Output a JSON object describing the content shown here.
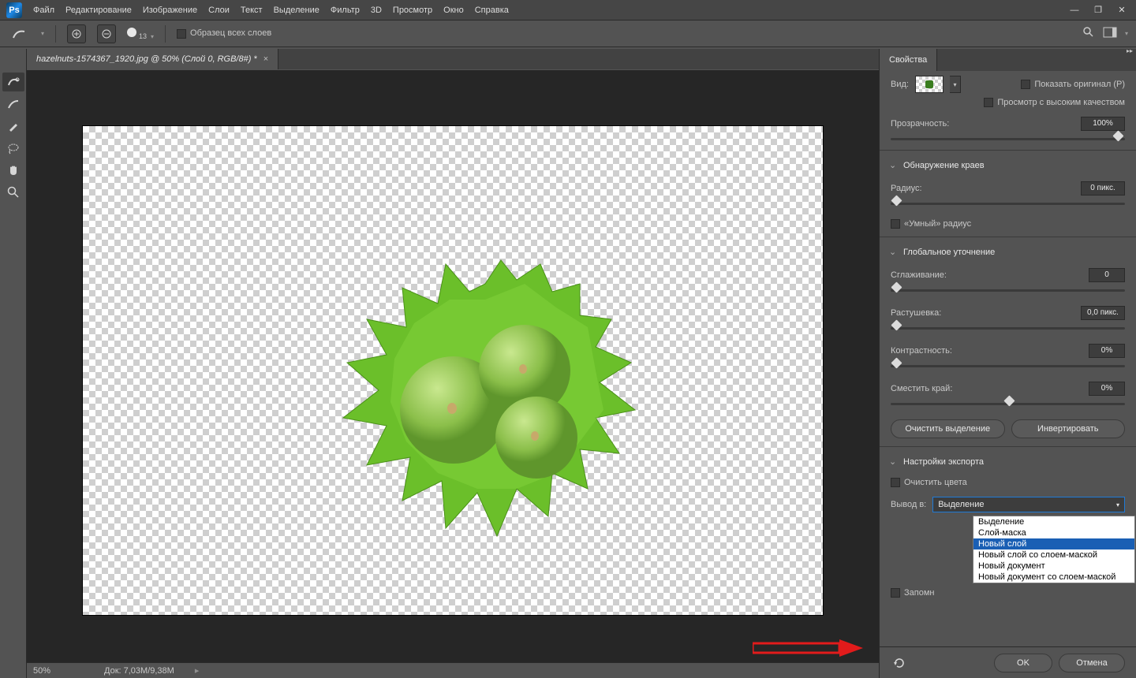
{
  "menu": {
    "items": [
      "Файл",
      "Редактирование",
      "Изображение",
      "Слои",
      "Текст",
      "Выделение",
      "Фильтр",
      "3D",
      "Просмотр",
      "Окно",
      "Справка"
    ]
  },
  "options": {
    "brush_size": "13",
    "sample_all": "Образец всех слоев"
  },
  "doc_tab": "hazelnuts-1574367_1920.jpg @ 50% (Слой 0, RGB/8#) *",
  "status": {
    "zoom": "50%",
    "doc": "Док: 7,03M/9,38M"
  },
  "panel": {
    "title": "Свойства",
    "view_label": "Вид:",
    "show_original": "Показать оригинал (P)",
    "high_quality": "Просмотр с высоким качеством",
    "transparency_label": "Прозрачность:",
    "transparency_value": "100%",
    "sections": {
      "edge": "Обнаружение краев",
      "refine": "Глобальное уточнение",
      "export": "Настройки экспорта"
    },
    "radius_label": "Радиус:",
    "radius_value": "0 пикс.",
    "smart_radius": "«Умный» радиус",
    "smooth_label": "Сглаживание:",
    "smooth_value": "0",
    "feather_label": "Растушевка:",
    "feather_value": "0,0 пикс.",
    "contrast_label": "Контрастность:",
    "contrast_value": "0%",
    "shift_label": "Сместить край:",
    "shift_value": "0%",
    "clear_btn": "Очистить выделение",
    "invert_btn": "Инвертировать",
    "decontaminate": "Очистить цвета",
    "output_label": "Вывод в:",
    "output_selected": "Выделение",
    "output_options": [
      "Выделение",
      "Слой-маска",
      "Новый слой",
      "Новый слой со слоем-маской",
      "Новый документ",
      "Новый документ со слоем-маской"
    ],
    "output_highlight_index": 2,
    "remember": "Запомн",
    "ok": "OK",
    "cancel": "Отмена"
  }
}
